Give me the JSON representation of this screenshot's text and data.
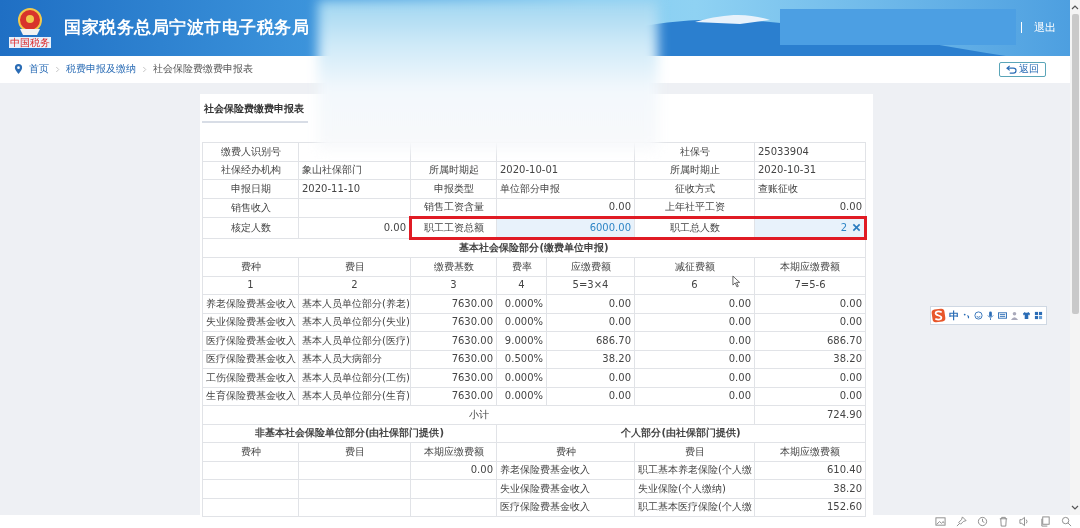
{
  "header": {
    "title": "国家税务总局宁波市电子税务局",
    "logo_caption": "中国税务",
    "logout": "退出"
  },
  "breadcrumb": {
    "items": [
      {
        "label": "首页"
      },
      {
        "label": "税费申报及缴纳"
      },
      {
        "label": "社会保险费缴费申报表"
      }
    ],
    "back_button": "返回"
  },
  "tabs": [
    {
      "label": "社会保险费缴费申报表",
      "selected": true
    }
  ],
  "info_rows": [
    {
      "fields": [
        {
          "kind": "text",
          "label": "缴费人识别号",
          "highlighted": false,
          "editable": false,
          "clearable": false
        },
        {
          "kind": "blank"
        },
        {
          "kind": "text",
          "label": "社保号",
          "value": "25033904",
          "highlighted": false,
          "editable": false,
          "clearable": false
        }
      ]
    },
    {
      "fields": [
        {
          "kind": "text",
          "label": "社保经办机构",
          "value": "象山社保部门",
          "highlighted": false,
          "editable": false,
          "clearable": false
        },
        {
          "kind": "text",
          "label": "所属时期起",
          "value": "2020-10-01",
          "highlighted": false,
          "editable": false,
          "clearable": false
        },
        {
          "kind": "text",
          "label": "所属时期止",
          "value": "2020-10-31",
          "highlighted": false,
          "editable": false,
          "clearable": false
        }
      ]
    },
    {
      "fields": [
        {
          "kind": "text",
          "label": "申报日期",
          "value": "2020-11-10",
          "highlighted": false,
          "editable": false,
          "clearable": false
        },
        {
          "kind": "text",
          "label": "申报类型",
          "value": "单位部分申报",
          "highlighted": false,
          "editable": false,
          "clearable": false
        },
        {
          "kind": "text",
          "label": "征收方式",
          "value": "查账征收",
          "highlighted": false,
          "editable": false,
          "clearable": false
        }
      ]
    },
    {
      "fields": [
        {
          "kind": "text",
          "label": "销售收入",
          "highlighted": false,
          "editable": false,
          "clearable": false
        },
        {
          "kind": "amount",
          "label": "销售工资含量",
          "value": "0.00",
          "highlighted": false,
          "editable": false,
          "clearable": false
        },
        {
          "kind": "amount",
          "label": "上年社平工资",
          "value": "0.00",
          "highlighted": false,
          "editable": false,
          "clearable": false
        }
      ]
    },
    {
      "fields": [
        {
          "kind": "amount",
          "label": "核定人数",
          "value": "0.00",
          "highlighted": false,
          "editable": false,
          "clearable": false
        },
        {
          "kind": "amount",
          "label": "职工工资总额",
          "value": "6000.00",
          "highlighted": true,
          "editable": true,
          "clearable": false
        },
        {
          "kind": "amount",
          "label": "职工总人数",
          "value": "2",
          "highlighted": true,
          "editable": true,
          "clearable": true
        }
      ]
    }
  ],
  "basic_section": {
    "title": "基本社会保险部分(缴费单位申报)",
    "columns": [
      "费种",
      "费目",
      "缴费基数",
      "费率",
      "应缴费额",
      "减征费额",
      "本期应缴费额"
    ],
    "column_numbers": [
      "1",
      "2",
      "3",
      "4",
      "5=3×4",
      "6",
      "7=5-6"
    ],
    "rows": [
      {
        "fee_type": "养老保险费基金收入",
        "item": "基本人员单位部分(养老)",
        "base": "7630.00",
        "rate": "0.000%",
        "payable": "0.00",
        "reduction": "0.00",
        "due": "0.00"
      },
      {
        "fee_type": "失业保险费基金收入",
        "item": "基本人员单位部分(失业)",
        "base": "7630.00",
        "rate": "0.000%",
        "payable": "0.00",
        "reduction": "0.00",
        "due": "0.00"
      },
      {
        "fee_type": "医疗保险费基金收入",
        "item": "基本人员单位部分(医疗)",
        "base": "7630.00",
        "rate": "9.000%",
        "payable": "686.70",
        "reduction": "0.00",
        "due": "686.70"
      },
      {
        "fee_type": "医疗保险费基金收入",
        "item": "基本人员大病部分",
        "base": "7630.00",
        "rate": "0.500%",
        "payable": "38.20",
        "reduction": "0.00",
        "due": "38.20"
      },
      {
        "fee_type": "工伤保险费基金收入",
        "item": "基本人员单位部分(工伤)",
        "base": "7630.00",
        "rate": "0.000%",
        "payable": "0.00",
        "reduction": "0.00",
        "due": "0.00"
      },
      {
        "fee_type": "生育保险费基金收入",
        "item": "基本人员单位部分(生育)",
        "base": "7630.00",
        "rate": "0.000%",
        "payable": "0.00",
        "reduction": "0.00",
        "due": "0.00"
      }
    ],
    "subtotal": {
      "label": "小计",
      "value": "724.90"
    }
  },
  "non_basic_section": {
    "title": "非基本社会保险单位部分(由社保部门提供)",
    "columns": [
      "费种",
      "费目",
      "本期应缴费额"
    ],
    "rows": [
      {
        "amount": "0.00"
      }
    ]
  },
  "personal_section": {
    "title": "个人部分(由社保部门提供)",
    "columns": [
      "费种",
      "费目",
      "本期应缴费额"
    ],
    "rows": [
      {
        "fee_type": "养老保险费基金收入",
        "item": "职工基本养老保险(个人缴",
        "amount": "610.40"
      },
      {
        "fee_type": "失业保险费基金收入",
        "item": "失业保险(个人缴纳)",
        "amount": "38.20"
      },
      {
        "fee_type": "医疗保险费基金收入",
        "item": "职工基本医疗保险(个人缴",
        "amount": "152.60"
      }
    ]
  },
  "ime_toolbar": {
    "mode": "中"
  }
}
